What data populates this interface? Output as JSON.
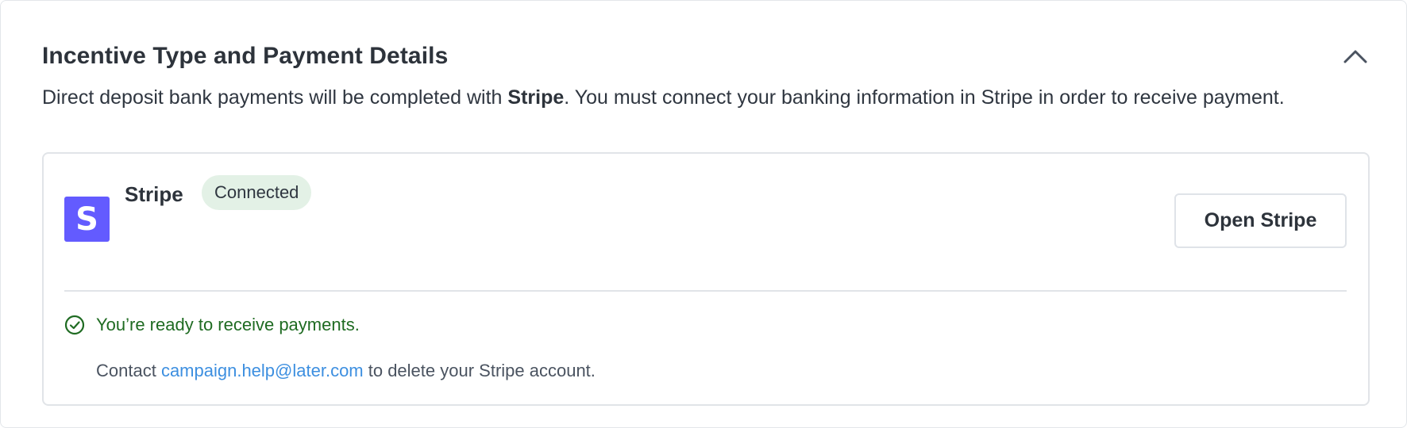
{
  "section": {
    "title": "Incentive Type and Payment Details",
    "collapse_icon": "chevron-up-icon",
    "description_prefix": "Direct deposit bank payments will be completed with ",
    "description_emphasis": "Stripe",
    "description_suffix": ". You must connect your banking information in Stripe in order to receive payment."
  },
  "stripe_card": {
    "logo_letter": "S",
    "logo_color": "#635bff",
    "name": "Stripe",
    "status_badge": "Connected",
    "status_badge_color": "#e3f1e6",
    "open_button_label": "Open Stripe",
    "ready_icon": "check-circle-icon",
    "ready_message": "You’re ready to receive payments.",
    "ready_color": "#1f6b22",
    "contact_prefix": "Contact ",
    "contact_email": "campaign.help@later.com",
    "contact_suffix": " to delete your Stripe account.",
    "link_color": "#3d8fe0"
  }
}
